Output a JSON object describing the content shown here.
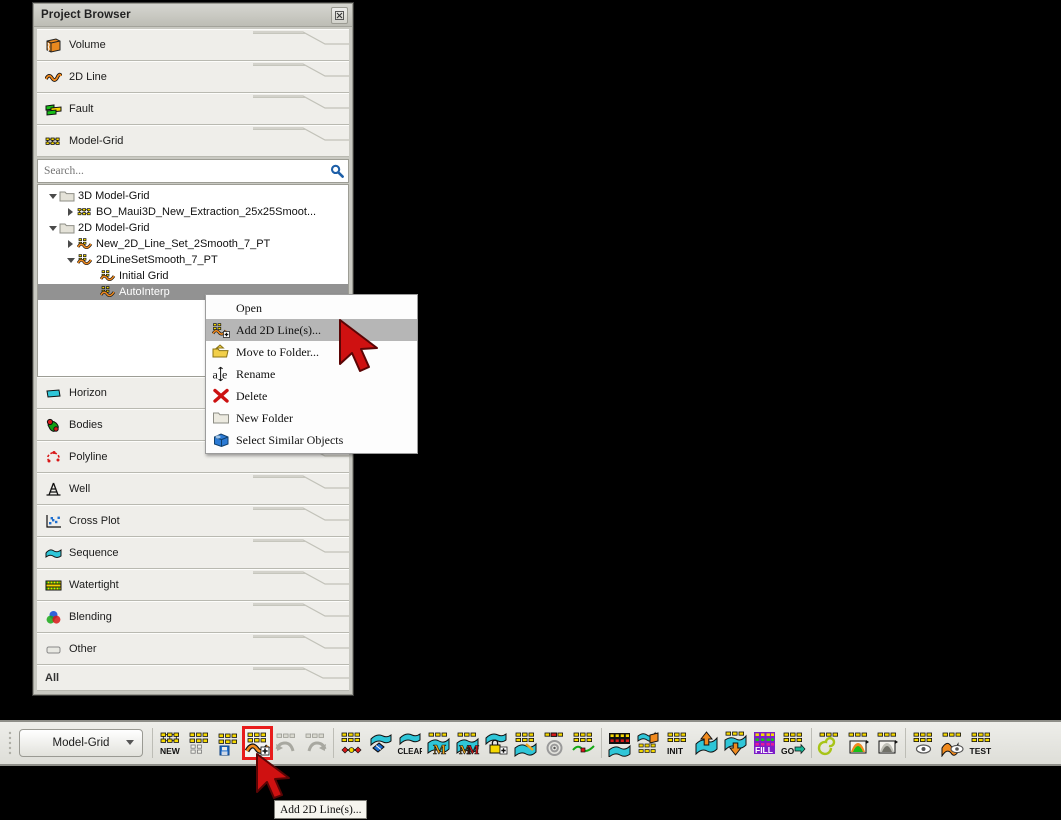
{
  "panel": {
    "title": "Project Browser",
    "close_icon": "close-icon",
    "categories_top": [
      {
        "label": "Volume",
        "icon": "volume-icon"
      },
      {
        "label": "2D Line",
        "icon": "2d-line-icon"
      },
      {
        "label": "Fault",
        "icon": "fault-icon"
      },
      {
        "label": "Model-Grid",
        "icon": "model-grid-icon"
      }
    ],
    "categories_bottom": [
      {
        "label": "Horizon",
        "icon": "horizon-icon"
      },
      {
        "label": "Bodies",
        "icon": "bodies-icon"
      },
      {
        "label": "Polyline",
        "icon": "polyline-icon"
      },
      {
        "label": "Well",
        "icon": "well-icon"
      },
      {
        "label": "Cross Plot",
        "icon": "cross-plot-icon"
      },
      {
        "label": "Sequence",
        "icon": "sequence-icon"
      },
      {
        "label": "Watertight",
        "icon": "watertight-icon"
      },
      {
        "label": "Blending",
        "icon": "blending-icon"
      },
      {
        "label": "Other",
        "icon": "other-icon"
      }
    ],
    "all_label": "All",
    "search": {
      "value": "",
      "placeholder": "Search...",
      "icon": "search-icon"
    },
    "tree": [
      {
        "label": "3D Model-Grid",
        "indent": 0,
        "twist": "down",
        "icon": "folder-icon",
        "selected": false
      },
      {
        "label": "BO_Maui3D_New_Extraction_25x25Smoot...",
        "indent": 1,
        "twist": "right",
        "icon": "model-grid-icon",
        "selected": false
      },
      {
        "label": "2D Model-Grid",
        "indent": 0,
        "twist": "down",
        "icon": "folder-icon",
        "selected": false
      },
      {
        "label": "New_2D_Line_Set_2Smooth_7_PT",
        "indent": 1,
        "twist": "right",
        "icon": "grid-2d-icon",
        "selected": false
      },
      {
        "label": "2DLineSetSmooth_7_PT",
        "indent": 1,
        "twist": "down",
        "icon": "grid-2d-icon",
        "selected": false
      },
      {
        "label": "Initial Grid",
        "indent": 2,
        "twist": "none",
        "icon": "grid-2d-icon",
        "selected": false
      },
      {
        "label": "AutoInterp",
        "indent": 2,
        "twist": "none",
        "icon": "grid-2d-icon",
        "selected": true
      }
    ]
  },
  "context_menu": {
    "items": [
      {
        "label": "Open",
        "icon": "",
        "highlighted": false
      },
      {
        "label": "Add 2D Line(s)...",
        "icon": "add-2d-line-icon",
        "highlighted": true
      },
      {
        "label": "Move to Folder...",
        "icon": "move-to-folder-icon",
        "highlighted": false
      },
      {
        "label": "Rename",
        "icon": "rename-icon",
        "highlighted": false
      },
      {
        "label": "Delete",
        "icon": "delete-icon",
        "highlighted": false
      },
      {
        "label": "New Folder",
        "icon": "new-folder-icon",
        "highlighted": false
      },
      {
        "label": "Select Similar Objects",
        "icon": "select-similar-objects-icon",
        "highlighted": false
      }
    ]
  },
  "toolbar": {
    "selected_type": "Model-Grid",
    "buttons": [
      {
        "name": "model-grid-new-button",
        "icon": "grid-new-icon",
        "label": "NEW",
        "active": false
      },
      {
        "name": "model-grid-open-button",
        "icon": "grid-open-icon",
        "label": "",
        "active": false
      },
      {
        "name": "model-grid-save-button",
        "icon": "grid-save-icon",
        "label": "",
        "active": false
      },
      {
        "name": "add-2d-lines-button",
        "icon": "grid-add-2d-line-icon",
        "label": "",
        "active": true
      },
      {
        "name": "model-grid-undo-button",
        "icon": "grid-undo-icon",
        "label": "",
        "active": false
      },
      {
        "name": "model-grid-redo-button",
        "icon": "grid-redo-icon",
        "label": "",
        "active": false
      },
      {
        "name": "model-grid-nodes-button",
        "icon": "grid-nodes-icon",
        "label": "",
        "active": false
      },
      {
        "name": "model-grid-erase-button",
        "icon": "erase-icon",
        "label": "",
        "active": false
      },
      {
        "name": "model-grid-clear-button",
        "icon": "clear-icon",
        "label": "CLEAR",
        "active": false
      },
      {
        "name": "model-grid-merge-button",
        "icon": "grid-merge-m-icon",
        "label": "",
        "active": false
      },
      {
        "name": "model-grid-merge-all-button",
        "icon": "grid-merge-m2-icon",
        "label": "",
        "active": false
      },
      {
        "name": "model-grid-lock-button",
        "icon": "lock-add-icon",
        "label": "",
        "active": false
      },
      {
        "name": "model-grid-edit-button",
        "icon": "grid-edit-icon",
        "label": "",
        "active": false
      },
      {
        "name": "model-grid-spiral-button",
        "icon": "grid-spiral-icon",
        "label": "",
        "active": false
      },
      {
        "name": "model-grid-snake-button",
        "icon": "grid-snake-icon",
        "label": "",
        "active": false
      },
      {
        "name": "model-grid-matrix-button",
        "icon": "grid-matrix-icon",
        "label": "",
        "active": false
      },
      {
        "name": "model-grid-surface-button",
        "icon": "grid-surface-icon",
        "label": "",
        "active": false
      },
      {
        "name": "model-grid-stack-button",
        "icon": "grid-stack-icon",
        "label": "",
        "active": false
      },
      {
        "name": "model-grid-init-button",
        "icon": "grid-init-icon",
        "label": "INIT",
        "active": false
      },
      {
        "name": "model-grid-up-button",
        "icon": "grid-up-arrow-icon",
        "label": "",
        "active": false
      },
      {
        "name": "model-grid-down-button",
        "icon": "grid-down-arrow-icon",
        "label": "",
        "active": false
      },
      {
        "name": "model-grid-fill-button",
        "icon": "grid-fill-icon",
        "label": "FILL",
        "active": false
      },
      {
        "name": "model-grid-go-button",
        "icon": "grid-go-icon",
        "label": "GO",
        "active": false
      },
      {
        "name": "model-grid-coil-button",
        "icon": "grid-coil-icon",
        "label": "",
        "active": false
      },
      {
        "name": "model-grid-color-button",
        "icon": "grid-color-icon",
        "label": "",
        "active": false
      },
      {
        "name": "model-grid-gray-button",
        "icon": "grid-gray-icon",
        "label": "",
        "active": false
      },
      {
        "name": "model-grid-view-button",
        "icon": "grid-eye-icon",
        "label": "",
        "active": false
      },
      {
        "name": "model-grid-view2-button",
        "icon": "grid-eye-orange-icon",
        "label": "",
        "active": false
      },
      {
        "name": "model-grid-test-button",
        "icon": "grid-test-icon",
        "label": "TEST",
        "active": false
      }
    ]
  },
  "tooltip": {
    "text": "Add 2D Line(s)..."
  },
  "colors": {
    "highlight_red": "#e81c1c",
    "selection_gray": "#929292",
    "menu_highlight": "#b6b6b6",
    "panel_bg": "#c9c9c2"
  }
}
